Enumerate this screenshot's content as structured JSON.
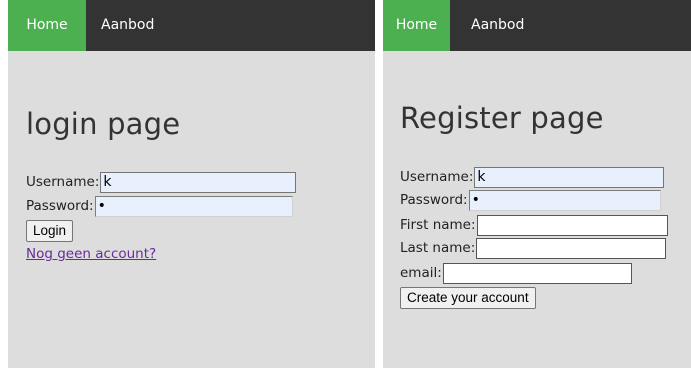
{
  "left_panel": {
    "nav": {
      "home": "Home",
      "aanbod": "Aanbod"
    },
    "title": "login page",
    "username": {
      "label": "Username:",
      "value": "k"
    },
    "password": {
      "label": "Password:",
      "value": "•"
    },
    "login_button": "Login",
    "register_link": "Nog geen account?"
  },
  "right_panel": {
    "nav": {
      "home": "Home",
      "aanbod": "Aanbod"
    },
    "title": "Register page",
    "username": {
      "label": "Username:",
      "value": "k"
    },
    "password": {
      "label": "Password:",
      "value": "•"
    },
    "first_name": {
      "label": "First name:",
      "value": ""
    },
    "last_name": {
      "label": "Last name:",
      "value": ""
    },
    "email": {
      "label": "email:",
      "value": ""
    },
    "create_button": "Create your account"
  },
  "colors": {
    "nav_bg": "#333333",
    "active_tab": "#4caf50",
    "panel_bg": "#dddddd",
    "link": "#6a2a9a"
  }
}
